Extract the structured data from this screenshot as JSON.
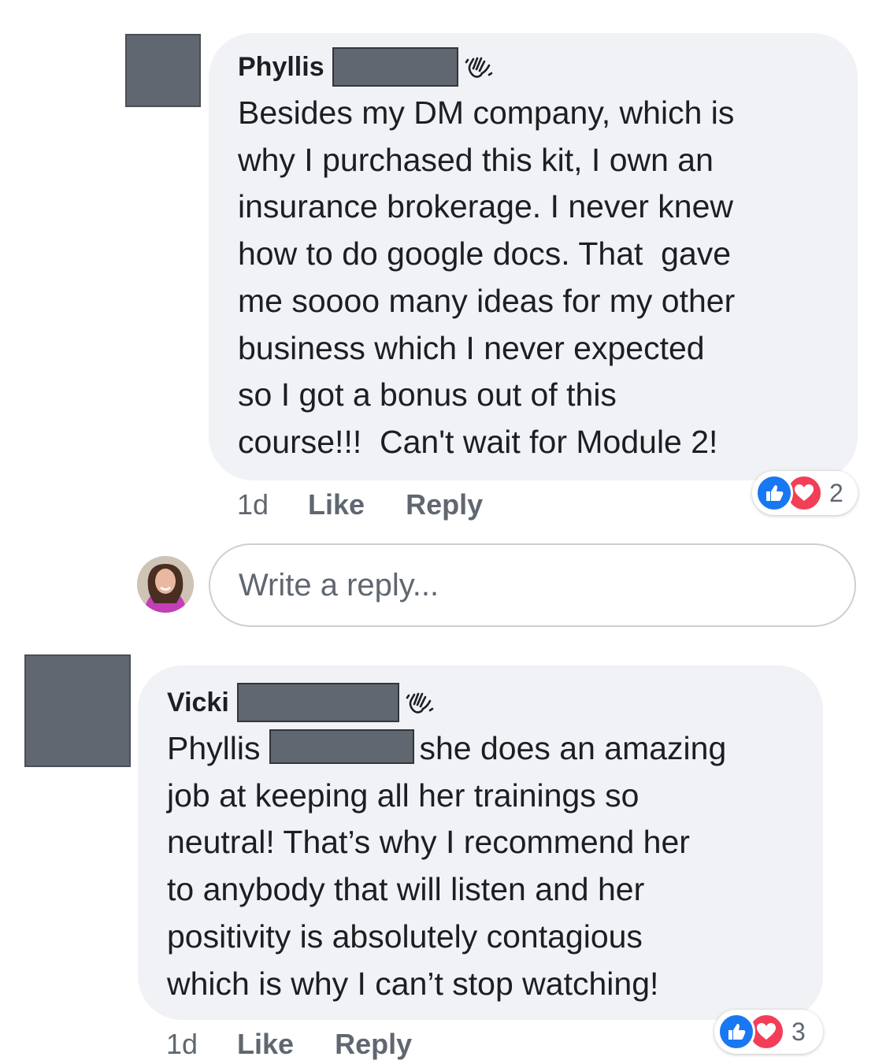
{
  "comments": [
    {
      "author": "Phyllis",
      "text": "Besides my DM company, which is\nwhy I purchased this kit, I own an\ninsurance brokerage. I never knew\nhow to do google docs. That  gave\nme soooo many ideas for my other\nbusiness which I never expected\nso I got a bonus out of this\ncourse!!!  Can't wait for Module 2!",
      "time": "1d",
      "like_label": "Like",
      "reply_label": "Reply",
      "reaction_count": "2"
    },
    {
      "author": "Vicki",
      "mention": "Phyllis",
      "text": "she does an amazing\njob at keeping all her trainings so\nneutral! That’s why I recommend her\nto anybody that will listen and her\npositivity is absolutely contagious\nwhich is why I can’t stop watching!",
      "time": "1d",
      "like_label": "Like",
      "reply_label": "Reply",
      "reaction_count": "3"
    }
  ],
  "reply_box": {
    "placeholder": "Write a reply..."
  },
  "colors": {
    "bubble": "#f0f2f5",
    "redaction": "#606770",
    "like_blue": "#1877f2",
    "love_red": "#f33e58",
    "meta_gray": "#606770"
  },
  "icons": [
    "wave-icon",
    "thumbs-up-icon",
    "heart-icon"
  ]
}
